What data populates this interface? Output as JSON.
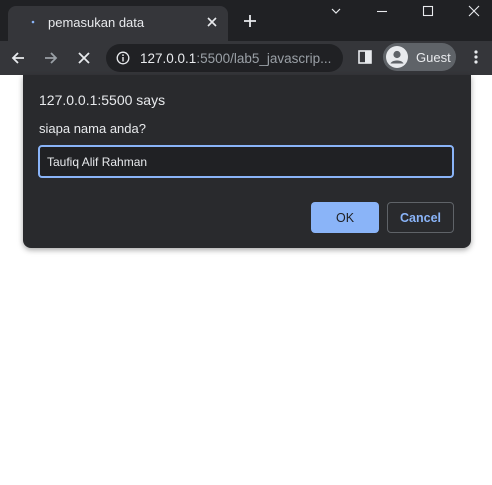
{
  "tab": {
    "title": "pemasukan data",
    "close_icon": "close-icon",
    "new_tab_icon": "plus-icon"
  },
  "window": {
    "minimize_icon": "minimize-icon",
    "maximize_icon": "maximize-icon",
    "close_icon": "close-icon",
    "dropdown_icon": "chevron-down-icon"
  },
  "toolbar": {
    "url_host": "127.0.0.1",
    "url_rest": ":5500/lab5_javascrip...",
    "profile_label": "Guest"
  },
  "dialog": {
    "title": "127.0.0.1:5500 says",
    "message": "siapa nama anda?",
    "input_value": "Taufiq Alif Rahman",
    "ok_label": "OK",
    "cancel_label": "Cancel"
  },
  "colors": {
    "frame": "#202124",
    "toolbar": "#35363a",
    "dialog": "#292a2d",
    "accent": "#8ab4f8"
  }
}
